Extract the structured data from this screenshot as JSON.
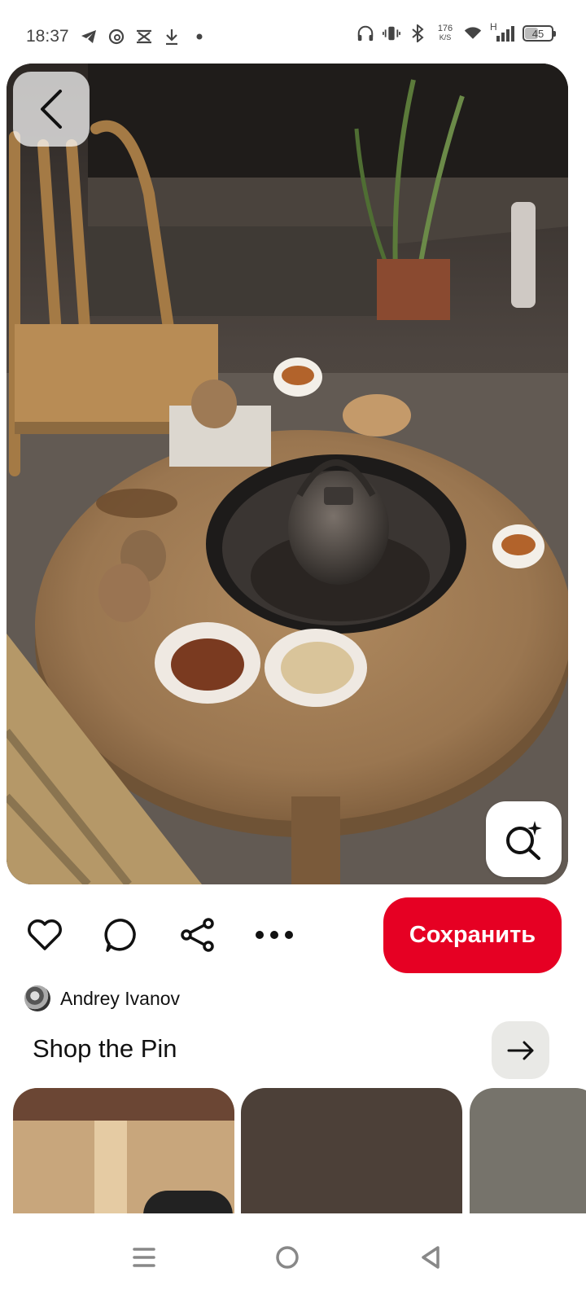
{
  "status_bar": {
    "time": "18:37",
    "left_icons": [
      "telegram-icon",
      "threads-icon",
      "capcut-icon",
      "download-icon",
      "dot-icon"
    ],
    "net_speed_value": "176",
    "net_speed_unit": "K/S",
    "network_type": "H",
    "battery": "45"
  },
  "pin": {
    "image_alt": "Round wooden table with an iron kettle over a sunken hearth, tea cups, small teapots, dishes of nuts and dried fruit, bamboo chair",
    "save_label": "Сохранить"
  },
  "author": {
    "name": "Andrey Ivanov"
  },
  "shop": {
    "title": "Shop the Pin"
  },
  "colors": {
    "save_button": "#e60023",
    "arrow_button_bg": "#e9e9e6"
  }
}
